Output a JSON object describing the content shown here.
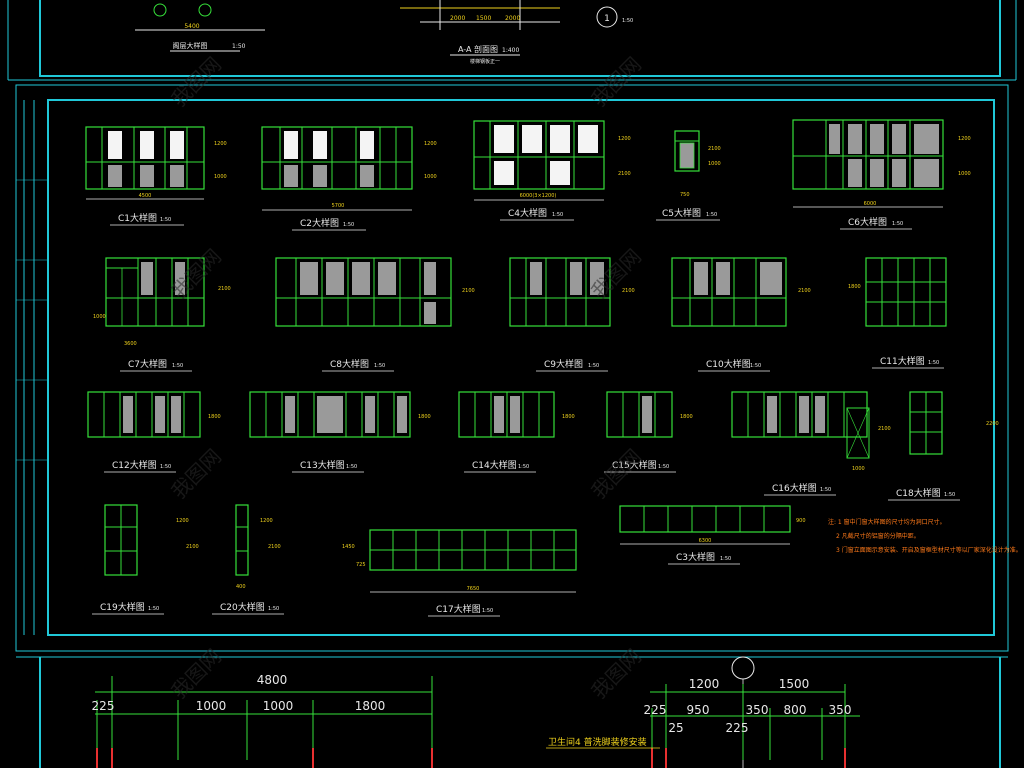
{
  "top": {
    "left_title": "阁层大样图",
    "left_scale": "1:50",
    "left_dim": "5400",
    "mid_title": "A-A 剖面图",
    "mid_scale": "1:400",
    "mid_sub": "楼梯钢板正一",
    "mid_dims": [
      "2000",
      "1500",
      "2000"
    ],
    "circle_label": "1",
    "circle_scale": "1:50"
  },
  "windows": [
    {
      "label": "C1大样图",
      "scale": "1:50",
      "width_dim": "4500",
      "h1": "1200",
      "h2": "1000"
    },
    {
      "label": "C2大样图",
      "scale": "1:50",
      "width_dim": "5700",
      "h1": "1200",
      "h2": "1000"
    },
    {
      "label": "C4大样图",
      "scale": "1:50",
      "width_dim": "6000(3×1200)",
      "h1": "1200",
      "h2": "2100"
    },
    {
      "label": "C5大样图",
      "scale": "1:50",
      "width_dim": "750",
      "h1": "2100",
      "h2": "1000"
    },
    {
      "label": "C6大样图",
      "scale": "1:50",
      "width_dim": "6000",
      "h1": "1200",
      "h2": "1000"
    },
    {
      "label": "C7大样图",
      "scale": "1:50",
      "width_dim": "3600",
      "h1": "2100",
      "h2": "1000"
    },
    {
      "label": "C8大样图",
      "scale": "1:50",
      "width_dim": "",
      "h1": "2100",
      "h2": ""
    },
    {
      "label": "C9大样图",
      "scale": "1:50",
      "width_dim": "",
      "h1": "2100",
      "h2": ""
    },
    {
      "label": "C10大样图",
      "scale": "1:50",
      "width_dim": "",
      "h1": "2100",
      "h2": ""
    },
    {
      "label": "C11大样图",
      "scale": "1:50",
      "width_dim": "",
      "h1": "1800",
      "h2": ""
    },
    {
      "label": "C12大样图",
      "scale": "1:50",
      "width_dim": "",
      "h1": "1800",
      "h2": ""
    },
    {
      "label": "C13大样图",
      "scale": "1:50",
      "width_dim": "",
      "h1": "1800",
      "h2": ""
    },
    {
      "label": "C14大样图",
      "scale": "1:50",
      "width_dim": "",
      "h1": "1800",
      "h2": ""
    },
    {
      "label": "C15大样图",
      "scale": "1:50",
      "width_dim": "",
      "h1": "1800",
      "h2": ""
    },
    {
      "label": "C16大样图",
      "scale": "1:50",
      "width_dim": "1000",
      "h1": "2100",
      "h2": ""
    },
    {
      "label": "C18大样图",
      "scale": "1:50",
      "width_dim": "",
      "h1": "2200",
      "h2": ""
    },
    {
      "label": "C19大样图",
      "scale": "1:50",
      "width_dim": "",
      "h1": "2100",
      "h2": "1200"
    },
    {
      "label": "C20大样图",
      "scale": "1:50",
      "width_dim": "400",
      "h1": "2100",
      "h2": "1200"
    },
    {
      "label": "C17大样图",
      "scale": "1:50",
      "width_dim": "7650",
      "h1": "1450",
      "h2": "725"
    },
    {
      "label": "C3大样图",
      "scale": "1:50",
      "width_dim": "6300",
      "h1": "900",
      "h2": ""
    }
  ],
  "notes": [
    "注: 1  窗中门窗大样图的尺寸均为洞口尺寸。",
    "2  凡截尺寸的铝窗的分隔中距。",
    "3  门窗立面图示意安装、开启及窗框型材尺寸等以厂家深化设计为准。"
  ],
  "bottom": {
    "dims_left_total": "4800",
    "dims_left": [
      "225",
      "1000",
      "1000",
      "1800"
    ],
    "dims_right_top": [
      "1200",
      "1500"
    ],
    "dims_right": [
      "225",
      "950",
      "350",
      "800",
      "350"
    ],
    "dims_right_sub": [
      "25",
      "225"
    ],
    "caption": "卫生间4 普洗脚装修安装"
  },
  "watermark": "我图网",
  "colors": {
    "frame": "#20c8d8",
    "window": "#36e03a",
    "label": "#e8e8e8",
    "dim": "#f0d21c",
    "note": "#ff7a1a"
  }
}
